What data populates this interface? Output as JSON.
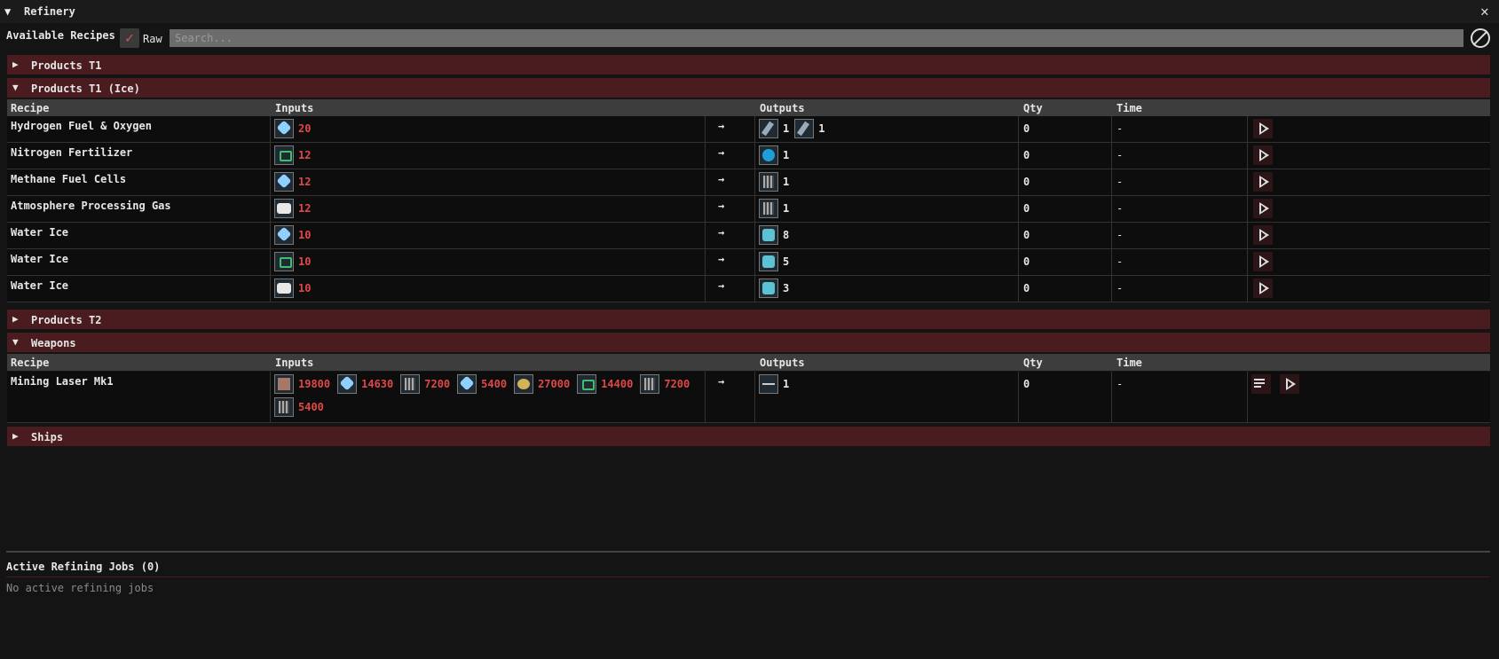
{
  "window": {
    "title": "Refinery",
    "close_icon": "close-icon"
  },
  "toolbar": {
    "available_label": "Available Recipes",
    "raw_label": "Raw",
    "search_placeholder": "Search..."
  },
  "sections": {
    "products_t1": "Products T1",
    "products_t1_ice": "Products T1 (Ice)",
    "products_t2": "Products T2",
    "weapons": "Weapons",
    "ships": "Ships"
  },
  "columns": {
    "recipe": "Recipe",
    "inputs": "Inputs",
    "outputs": "Outputs",
    "qty": "Qty",
    "time": "Time"
  },
  "arrow": "→",
  "ice_recipes": [
    {
      "name": "Hydrogen Fuel & Oxygen",
      "inputs": [
        {
          "icon": "ice-crystal-icon",
          "qty": "20"
        }
      ],
      "outputs": [
        {
          "icon": "hydrogen-icon",
          "qty": "1"
        },
        {
          "icon": "oxygen-icon",
          "qty": "1"
        }
      ],
      "qty": "0",
      "time": "-"
    },
    {
      "name": "Nitrogen Fertilizer",
      "inputs": [
        {
          "icon": "nitrogen-ice-icon",
          "qty": "12"
        }
      ],
      "outputs": [
        {
          "icon": "fertilizer-icon",
          "qty": "1"
        }
      ],
      "qty": "0",
      "time": "-"
    },
    {
      "name": "Methane Fuel Cells",
      "inputs": [
        {
          "icon": "ice-crystal-icon",
          "qty": "12"
        }
      ],
      "outputs": [
        {
          "icon": "fuel-cell-icon",
          "qty": "1"
        }
      ],
      "qty": "0",
      "time": "-"
    },
    {
      "name": "Atmosphere Processing Gas",
      "inputs": [
        {
          "icon": "white-ice-icon",
          "qty": "12"
        }
      ],
      "outputs": [
        {
          "icon": "gas-canister-icon",
          "qty": "1"
        }
      ],
      "qty": "0",
      "time": "-"
    },
    {
      "name": "Water Ice",
      "inputs": [
        {
          "icon": "ice-crystal-icon",
          "qty": "10"
        }
      ],
      "outputs": [
        {
          "icon": "water-ice-icon",
          "qty": "8"
        }
      ],
      "qty": "0",
      "time": "-"
    },
    {
      "name": "Water Ice",
      "inputs": [
        {
          "icon": "nitrogen-ice-icon",
          "qty": "10"
        }
      ],
      "outputs": [
        {
          "icon": "water-ice-icon",
          "qty": "5"
        }
      ],
      "qty": "0",
      "time": "-"
    },
    {
      "name": "Water Ice",
      "inputs": [
        {
          "icon": "white-ice-icon",
          "qty": "10"
        }
      ],
      "outputs": [
        {
          "icon": "water-ice-icon",
          "qty": "3"
        }
      ],
      "qty": "0",
      "time": "-"
    }
  ],
  "weapon_recipe": {
    "name": "Mining Laser Mk1",
    "inputs": [
      {
        "icon": "rust-ore-icon",
        "qty": "19800"
      },
      {
        "icon": "ice-crystal-icon",
        "qty": "14630"
      },
      {
        "icon": "scrap-icon",
        "qty": "7200"
      },
      {
        "icon": "crystal-shard-icon",
        "qty": "5400"
      },
      {
        "icon": "gold-ore-icon",
        "qty": "27000"
      },
      {
        "icon": "green-ore-icon",
        "qty": "14400"
      },
      {
        "icon": "dark-ore-icon",
        "qty": "7200"
      },
      {
        "icon": "wire-icon",
        "qty": "5400"
      }
    ],
    "outputs": [
      {
        "icon": "mining-laser-icon",
        "qty": "1"
      }
    ],
    "qty": "0",
    "time": "-"
  },
  "jobs": {
    "title": "Active Refining Jobs (0)",
    "empty": "No active refining jobs"
  }
}
